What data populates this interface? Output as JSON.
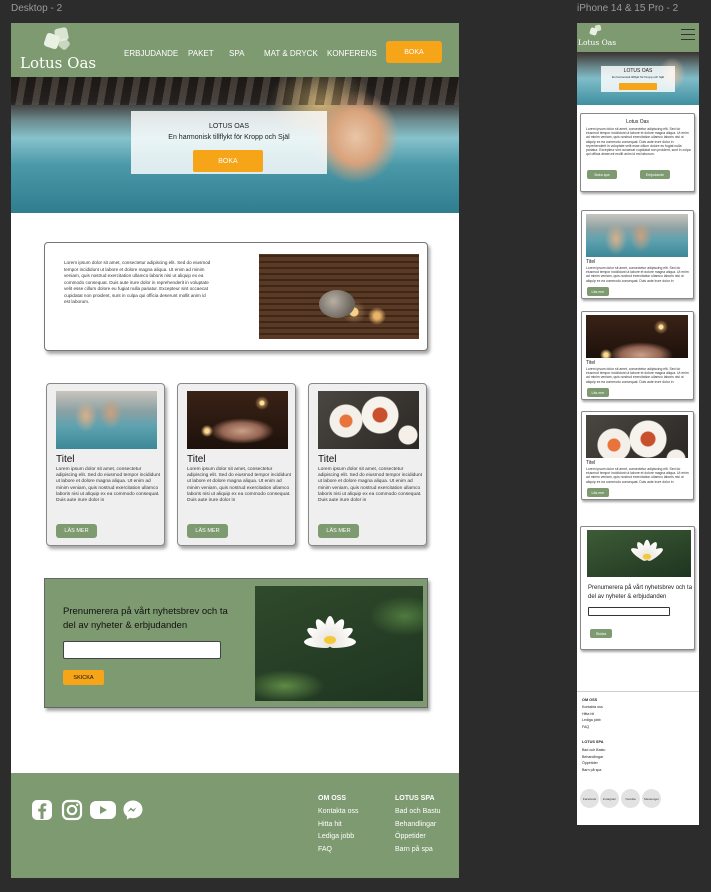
{
  "canvas": {
    "desktop_label": "Desktop - 2",
    "phone_label": "iPhone 14 & 15 Pro - 2"
  },
  "brand": {
    "logo_text": "Lotus Oas",
    "green": "#7e9a70",
    "orange": "#f6a418"
  },
  "desktop": {
    "nav": {
      "items": [
        {
          "label": "ERBJUDANDE"
        },
        {
          "label": "PAKET"
        },
        {
          "label": "SPA"
        },
        {
          "label": "MAT & DRYCK"
        },
        {
          "label": "KONFERENS"
        }
      ],
      "cta": "BOKA"
    },
    "hero": {
      "title": "LOTUS OAS",
      "subtitle": "En harmonisk tillflykt för Kropp och Själ",
      "button": "BOKA"
    },
    "intro": {
      "text": "Lorem ipsum dolor sit amet, consectetur adipiscing elit. Sed do eiusmod tempor incididunt ut labore et dolore magna aliqua. Ut enim ad minim veniam, quis nostrud exercitation ullamco laboris nisi ut aliquip ex ea commodo consequat. Duis aute irure dolor in reprehenderit in voluptate velit esse cillum dolore eu fugiat nulla pariatur. Excepteur sint occaecat cupidatat non proident, sunt in culpa qui officia deserunt mollit anim id est laborum."
    },
    "cards": [
      {
        "title": "Titel",
        "text": "Lorem ipsum dolor sit amet, consectetur adipiscing elit. Sed do eiusmod tempor incididunt ut labore et dolore magna aliqua. Ut enim ad minim veniam, quis nostrud exercitation ullamco laboris nisi ut aliquip ex ea commodo consequat. Duis aute irure dolor in",
        "button": "LÄS MER"
      },
      {
        "title": "Titel",
        "text": "Lorem ipsum dolor sit amet, consectetur adipiscing elit. Sed do eiusmod tempor incididunt ut labore et dolore magna aliqua. Ut enim ad minim veniam, quis nostrud exercitation ullamco laboris nisi ut aliquip ex ea commodo consequat. Duis aute irure dolor in",
        "button": "LÄS MER"
      },
      {
        "title": "Titel",
        "text": "Lorem ipsum dolor sit amet, consectetur adipiscing elit. Sed do eiusmod tempor incididunt ut labore et dolore magna aliqua. Ut enim ad minim veniam, quis nostrud exercitation ullamco laboris nisi ut aliquip ex ea commodo consequat. Duis aute irure dolor in",
        "button": "LÄS MER"
      }
    ],
    "newsletter": {
      "title": "Prenumerera på vårt nyhetsbrev och ta del av nyheter & erbjudanden",
      "button": "SKICKA"
    },
    "footer": {
      "social": [
        "facebook-icon",
        "instagram-icon",
        "youtube-icon",
        "messenger-icon"
      ],
      "col1": {
        "heading": "OM OSS",
        "items": [
          "Kontakta oss",
          "Hitta hit",
          "Lediga jobb",
          "FAQ"
        ]
      },
      "col2": {
        "heading": "LOTUS SPA",
        "items": [
          "Bad och Bastu",
          "Behandlingar",
          "Öppetider",
          "Barn på spa"
        ]
      }
    }
  },
  "phone": {
    "hero": {
      "title": "LOTUS OAS",
      "subtitle": "En harmonisk tillflykt för Kropp och Själ"
    },
    "intro": {
      "title": "Lotus Oas",
      "text": "Lorem ipsum dolor sit amet, consectetur adipiscing elit. Sed do eiusmod tempor incididunt ut labore et dolore magna aliqua. Ut enim ad minim veniam, quis nostrud exercitation ullamco laboris nisi ut aliquip ex ea commodo consequat. Duis aute irure dolor in reprehenderit in voluptate velit esse cillum dolore eu fugiat nulla pariatur. Excepteur sint occaecat cupidatat non proident, sunt in culpa qui officia deserunt mollit anim id est laborum.",
      "btn1": "Boka spa",
      "btn2": "Erbjudande"
    },
    "cards": [
      {
        "title": "Titel",
        "text": "Lorem ipsum dolor sit amet, consectetur adipiscing elit. Sed do eiusmod tempor incididunt ut labore et dolore magna aliqua. Ut enim ad minim veniam, quis nostrud exercitation ullamco laboris nisi ut aliquip ex ea commodo consequat. Duis aute irure dolor in",
        "button": "Läs mer"
      },
      {
        "title": "Titel",
        "text": "Lorem ipsum dolor sit amet, consectetur adipiscing elit. Sed do eiusmod tempor incididunt ut labore et dolore magna aliqua. Ut enim ad minim veniam, quis nostrud exercitation ullamco laboris nisi ut aliquip ex ea commodo consequat. Duis aute irure dolor in",
        "button": "Läs mer"
      },
      {
        "title": "Titel",
        "text": "Lorem ipsum dolor sit amet, consectetur adipiscing elit. Sed do eiusmod tempor incididunt ut labore et dolore magna aliqua. Ut enim ad minim veniam, quis nostrud exercitation ullamco laboris nisi ut aliquip ex ea commodo consequat. Duis aute irure dolor in",
        "button": "Läs mer"
      }
    ],
    "newsletter": {
      "title": "Prenumerera på vårt nyhetsbrev och ta del av nyheter & erbjudanden",
      "button": "Skicka"
    },
    "footer": {
      "col1": {
        "heading": "OM OSS",
        "items": [
          "Kontakta oss",
          "Hitta hit",
          "Lediga jobb",
          "FAQ"
        ]
      },
      "col2": {
        "heading": "LOTUS SPA",
        "items": [
          "Bad och Bastu",
          "Behandlingar",
          "Öppetider",
          "Barn på spa"
        ]
      },
      "social": [
        "Facebook",
        "Instagram",
        "Youtube",
        "Messenger"
      ]
    }
  }
}
